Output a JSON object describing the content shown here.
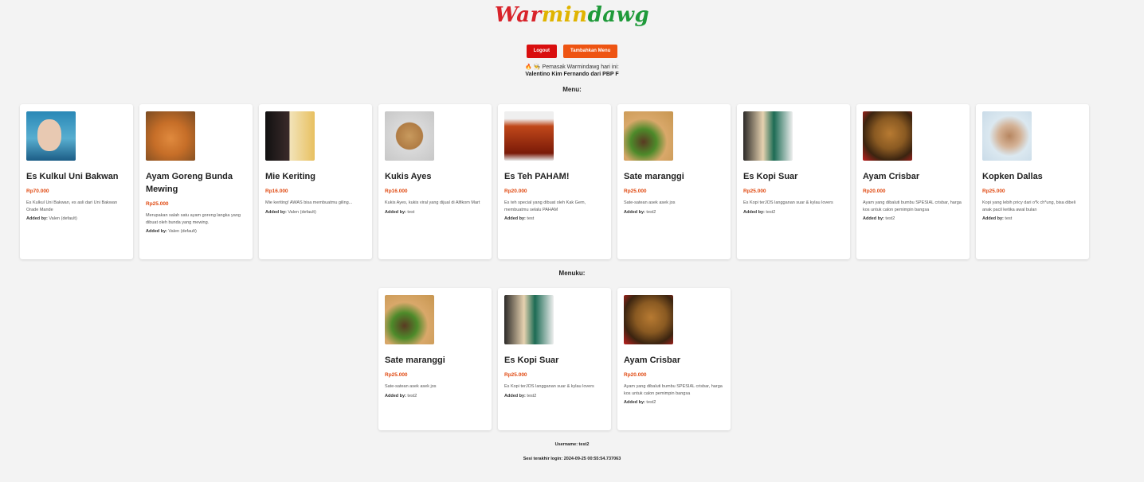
{
  "brand": {
    "logo_part1": "War",
    "logo_part2": "min",
    "logo_part3": "dawg"
  },
  "actions": {
    "logout_label": "Logout",
    "add_menu_label": "Tambahkan Menu"
  },
  "cook": {
    "line1": "🔥 👨‍🍳 Pemasak Warmindawg hari ini:",
    "line2": "Valentino Kim Fernando dari PBP F"
  },
  "menu_section": {
    "title": "Menu:",
    "items": [
      {
        "name": "Es Kulkul Uni Bakwan",
        "price": "Rp70.000",
        "desc": "Es Kulkul Uni Bakwan, es asli dari Uni Bakwan Orade Mande",
        "added_label": "Added by:",
        "added_by": "Valen (default)"
      },
      {
        "name": "Ayam Goreng Bunda Mewing",
        "price": "Rp25.000",
        "desc": "Merupakan salah satu ayam goreng langka yang dibuat oleh bunda yang mewing.",
        "added_label": "Added by:",
        "added_by": "Valen (default)"
      },
      {
        "name": "Mie Keriting",
        "price": "Rp16.000",
        "desc": "Mie keriting! AWAS bisa membuatmu giling...",
        "added_label": "Added by:",
        "added_by": "Valen (default)"
      },
      {
        "name": "Kukis Ayes",
        "price": "Rp16.000",
        "desc": "Kukis Ayes, kukis viral yang dijual di Alfikom Mart",
        "added_label": "Added by:",
        "added_by": "test"
      },
      {
        "name": "Es Teh PAHAM!",
        "price": "Rp20.000",
        "desc": "Es teh special yang dibuat oleh Kak Gem, membuatmu selalu PAHAM",
        "added_label": "Added by:",
        "added_by": "test"
      },
      {
        "name": "Sate maranggi",
        "price": "Rp25.000",
        "desc": "Sate-satean asek asek jos",
        "added_label": "Added by:",
        "added_by": "test2"
      },
      {
        "name": "Es Kopi Suar",
        "price": "Rp25.000",
        "desc": "Es Kopi terJOS langganan suar & kylau lovers",
        "added_label": "Added by:",
        "added_by": "test2"
      },
      {
        "name": "Ayam Crisbar",
        "price": "Rp20.000",
        "desc": "Ayam yang dibaluti bumbu SPESIAL crisbar, harga kos untuk calon pemimpin bangsa",
        "added_label": "Added by:",
        "added_by": "test2"
      },
      {
        "name": "Kopken Dallas",
        "price": "Rp25.000",
        "desc": "Kopi yang lebih pricy dari o*k ch*ung, bisa dibeli anak pacil ketika awal bulan",
        "added_label": "Added by:",
        "added_by": "test"
      }
    ]
  },
  "my_menu_section": {
    "title": "Menuku:",
    "items": [
      {
        "name": "Sate maranggi",
        "price": "Rp25.000",
        "desc": "Sate-satean asek asek jos",
        "added_label": "Added by:",
        "added_by": "test2"
      },
      {
        "name": "Es Kopi Suar",
        "price": "Rp25.000",
        "desc": "Es Kopi terJOS langganan suar & kylau lovers",
        "added_label": "Added by:",
        "added_by": "test2"
      },
      {
        "name": "Ayam Crisbar",
        "price": "Rp20.000",
        "desc": "Ayam yang dibaluti bumbu SPESIAL crisbar, harga kos untuk calon pemimpin bangsa",
        "added_label": "Added by:",
        "added_by": "test2"
      }
    ]
  },
  "footer": {
    "username": "Username: test2",
    "last_login": "Sesi terakhir login: 2024-09-25 00:55:54.737063"
  },
  "colors": {
    "logout": "#d90e0e",
    "add_menu": "#ee5412",
    "price": "#e04a12",
    "background": "#f3f3f3"
  }
}
